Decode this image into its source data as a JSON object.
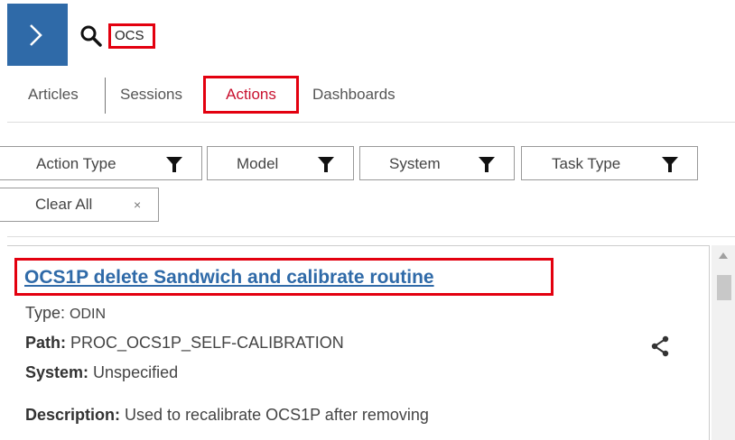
{
  "search": {
    "value": "OCS"
  },
  "tabs": [
    {
      "label": "Articles"
    },
    {
      "label": "Sessions"
    },
    {
      "label": "Actions"
    },
    {
      "label": "Dashboards"
    }
  ],
  "filters": [
    {
      "label": "Action Type"
    },
    {
      "label": "Model"
    },
    {
      "label": "System"
    },
    {
      "label": "Task Type"
    }
  ],
  "clear_all": {
    "label": "Clear All",
    "close_glyph": "×"
  },
  "result": {
    "title": "OCS1P delete Sandwich and calibrate routine",
    "type_label": "Type:",
    "type_value": "ODIN",
    "path_label": "Path:",
    "path_value": "PROC_OCS1P_SELF-CALIBRATION",
    "system_label": "System:",
    "system_value": "Unspecified",
    "description_label": "Description:",
    "description_value": "Used to recalibrate OCS1P after removing"
  },
  "colors": {
    "accent_blue": "#2f6aa8",
    "highlight_red": "#e3000f",
    "active_tab_red": "#c8102e"
  },
  "icons": [
    "chevron-right-icon",
    "search-icon",
    "funnel-icon",
    "close-icon",
    "share-icon"
  ]
}
